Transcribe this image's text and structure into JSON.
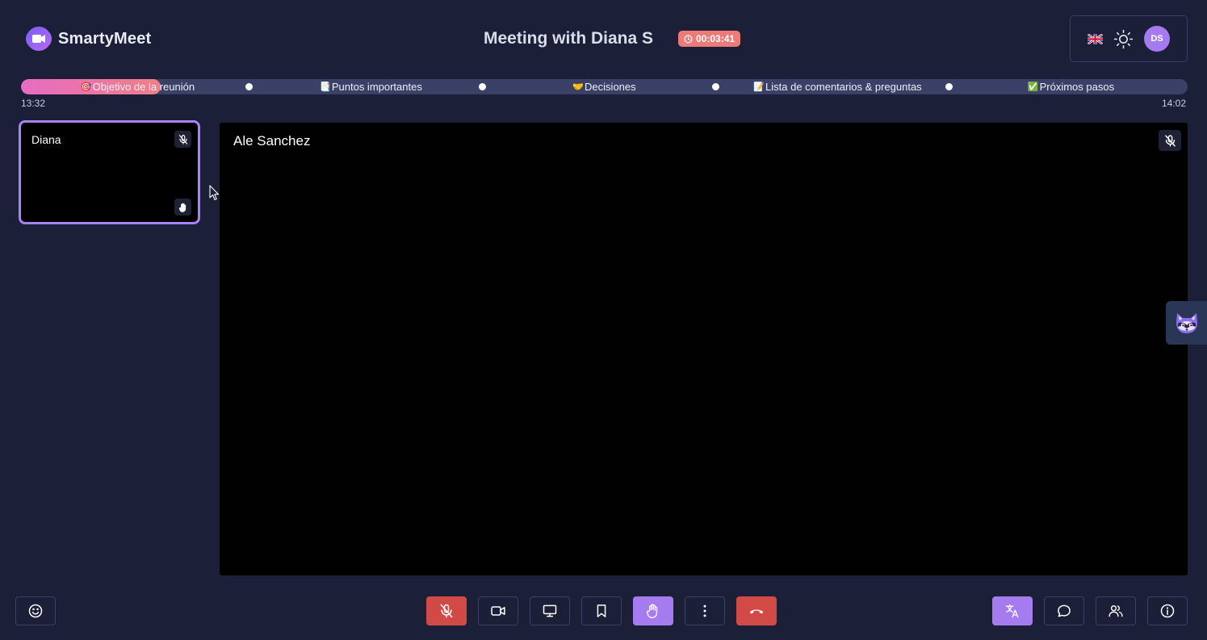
{
  "app": {
    "name": "SmartyMeet",
    "logo_icon": "video-camera-logo-icon"
  },
  "header": {
    "meeting_title": "Meeting with Diana S",
    "timer": "00:03:41",
    "timer_icon": "clock-icon",
    "language_icon": "uk-flag-icon",
    "theme_icon": "sun-icon",
    "avatar_initials": "DS"
  },
  "agenda": {
    "progress_fraction": 0.12,
    "items": [
      {
        "emoji": "🎯",
        "label": "Objetivo de la reunión"
      },
      {
        "emoji": "📑",
        "label": "Puntos importantes"
      },
      {
        "emoji": "🤝",
        "label": "Decisiones"
      },
      {
        "emoji": "📝",
        "label": "Lista de comentarios & preguntas"
      },
      {
        "emoji": "✅",
        "label": "Próximos pasos"
      }
    ],
    "start_time": "13:32",
    "end_time": "14:02"
  },
  "participants": [
    {
      "name": "Diana",
      "muted": true,
      "hand_raised": true,
      "active_speaker": true
    }
  ],
  "main_video": {
    "name": "Ale Sanchez",
    "muted": true
  },
  "assistant": {
    "icon": "raccoon-assistant-icon"
  },
  "toolbar": {
    "left": [
      {
        "icon": "emoji-smile-icon"
      }
    ],
    "center": [
      {
        "icon": "mic-off-icon",
        "state": "muted"
      },
      {
        "icon": "video-camera-icon"
      },
      {
        "icon": "screen-share-icon"
      },
      {
        "icon": "bookmark-icon"
      },
      {
        "icon": "raise-hand-icon",
        "state": "active"
      },
      {
        "icon": "more-options-icon"
      },
      {
        "icon": "end-call-icon"
      }
    ],
    "right": [
      {
        "icon": "translate-icon",
        "state": "active"
      },
      {
        "icon": "chat-icon"
      },
      {
        "icon": "participants-icon"
      },
      {
        "icon": "info-icon"
      }
    ]
  },
  "colors": {
    "background": "#1b1f37",
    "accent_purple": "#a67bf0",
    "danger_red": "#d24a45",
    "timer_badge": "#ec7b77",
    "progress_pink": "#e76cc4"
  }
}
